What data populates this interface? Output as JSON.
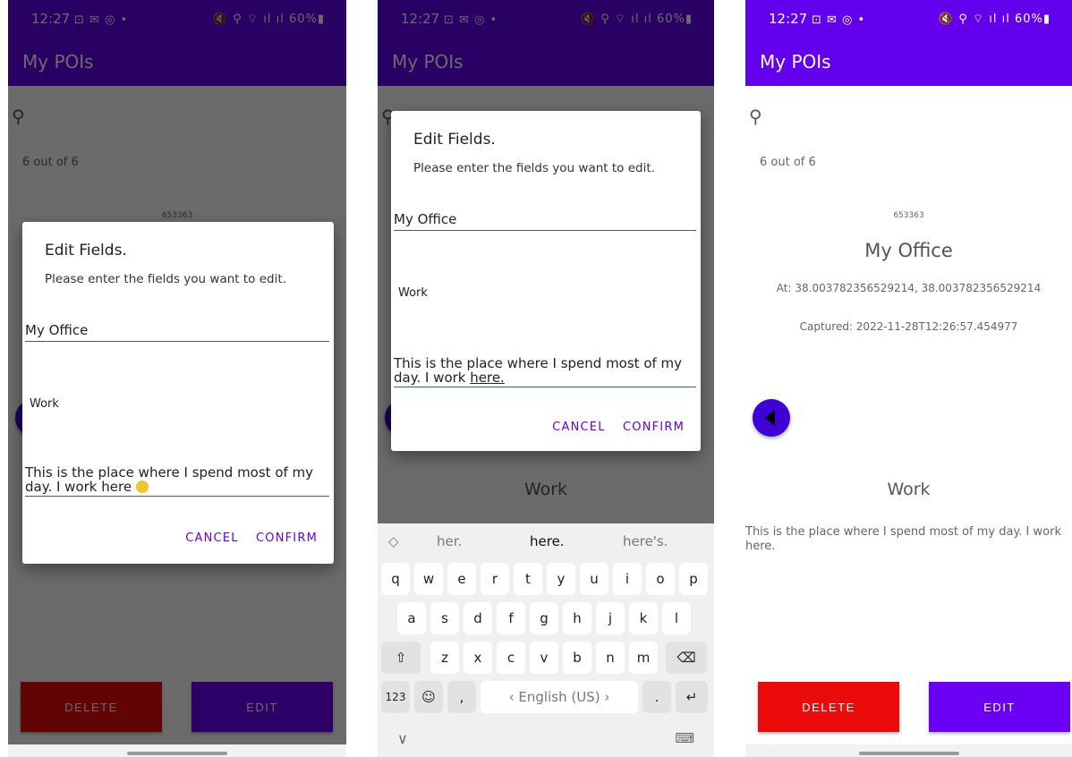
{
  "colors": {
    "primary": "#6200ee",
    "delete_red": "#ec0b0b",
    "edit_purple": "#6a00f4",
    "fab_blue": "#3f00d6"
  },
  "status_bar": {
    "time": "12:27",
    "left_icons": "⊡ ✉ ◎ •",
    "right_icons": "🔇 ⚲ ⌔ ıl ıl 60%▮"
  },
  "app": {
    "title": "My POIs"
  },
  "poi": {
    "count_text": "6 out of 6",
    "id": "653363",
    "name": "My Office",
    "at": "At: 38.003782356529214, 38.003782356529214",
    "captured": "Captured: 2022-11-28T12:26:57.454977",
    "category": "Work",
    "description": "This is the place where I spend most of my day. I work here."
  },
  "buttons": {
    "delete": "DELETE",
    "edit": "EDIT"
  },
  "dialog": {
    "title": "Edit Fields.",
    "message": "Please enter the fields you want to edit.",
    "name_value": "My Office",
    "category_value": "Work",
    "desc_value_emoji": "This is the place where I spend most of my day. I work here",
    "desc_prefix": "This is the place where I spend most of my day. I work ",
    "desc_typed_word": "here.",
    "cancel": "CANCEL",
    "confirm": "CONFIRM"
  },
  "keyboard": {
    "suggestions": [
      "her.",
      "here.",
      "here's."
    ],
    "row1": [
      "q",
      "w",
      "e",
      "r",
      "t",
      "y",
      "u",
      "i",
      "o",
      "p"
    ],
    "row2": [
      "a",
      "s",
      "d",
      "f",
      "g",
      "h",
      "j",
      "k",
      "l"
    ],
    "row3": [
      "z",
      "x",
      "c",
      "v",
      "b",
      "n",
      "m"
    ],
    "shift": "⇧",
    "backspace": "⌫",
    "num_key": "123",
    "emoji_key": "☺",
    "comma_key": ",",
    "space_label": "English (US)",
    "space_left_arrow": "‹",
    "space_right_arrow": "›",
    "period_key": ".",
    "enter_key": "↵",
    "collapse_icon": "∨",
    "keyboard_icon": "⌨",
    "sugg_toggle": "◇"
  }
}
